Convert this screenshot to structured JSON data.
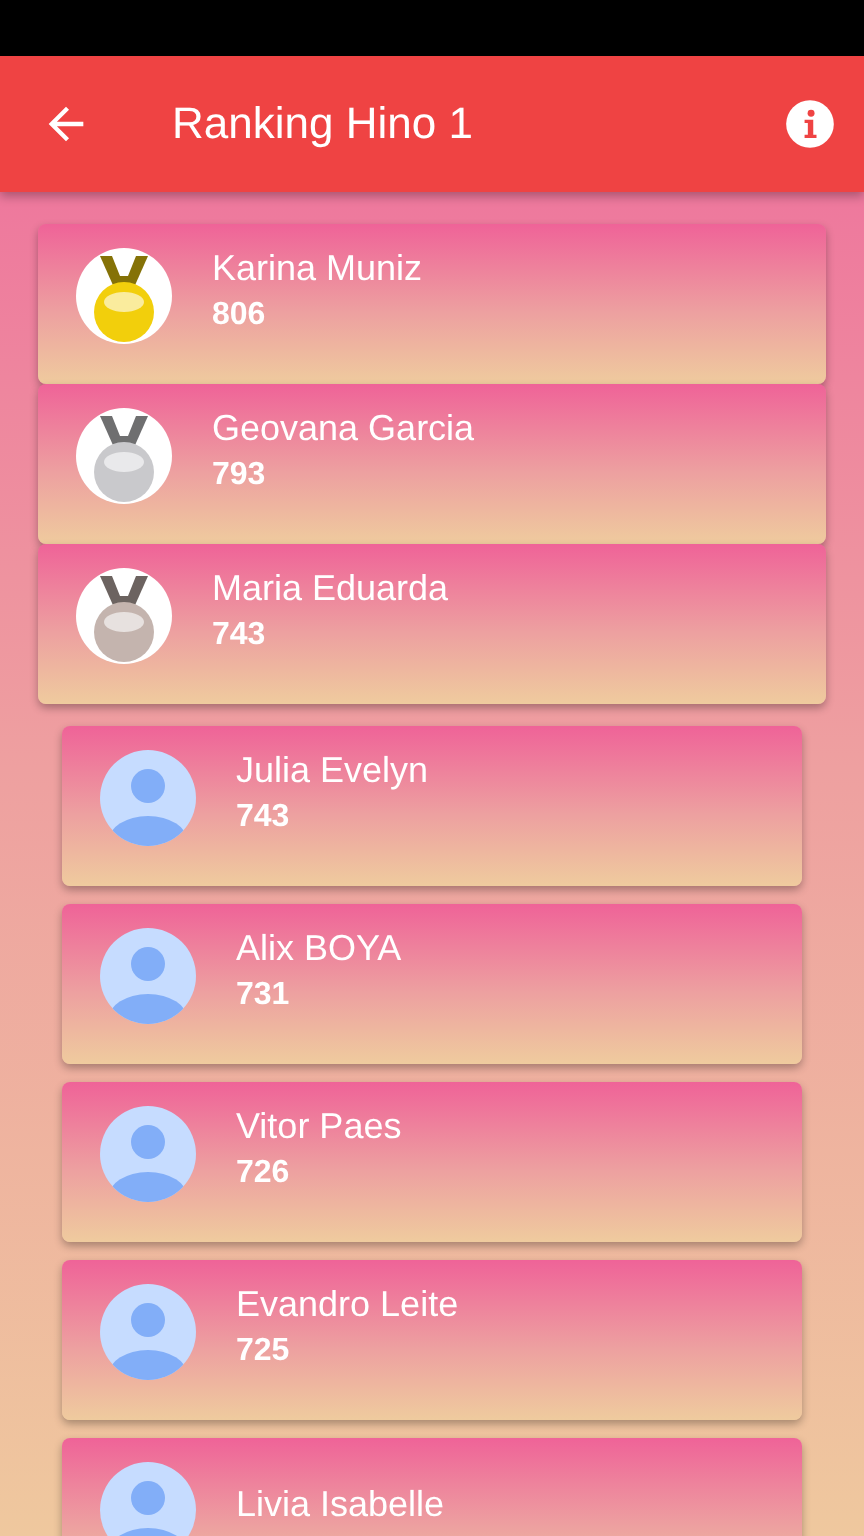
{
  "app_bar": {
    "title": "Ranking Hino 1"
  },
  "ranking": [
    {
      "kind": "medal",
      "name": "Karina Muniz",
      "score": "806",
      "color": "#f2cf0c"
    },
    {
      "kind": "medal",
      "name": "Geovana Garcia",
      "score": "793",
      "color": "#c9c9cc"
    },
    {
      "kind": "medal",
      "name": "Maria Eduarda",
      "score": "743",
      "color": "#c4b4ae"
    },
    {
      "kind": "person",
      "name": "Julia Evelyn",
      "score": "743"
    },
    {
      "kind": "person",
      "name": "Alix BOYA",
      "score": "731"
    },
    {
      "kind": "person",
      "name": "Vitor Paes",
      "score": "726"
    },
    {
      "kind": "person",
      "name": "Evandro Leite",
      "score": "725"
    },
    {
      "kind": "person",
      "name": "Livia Isabelle"
    }
  ]
}
